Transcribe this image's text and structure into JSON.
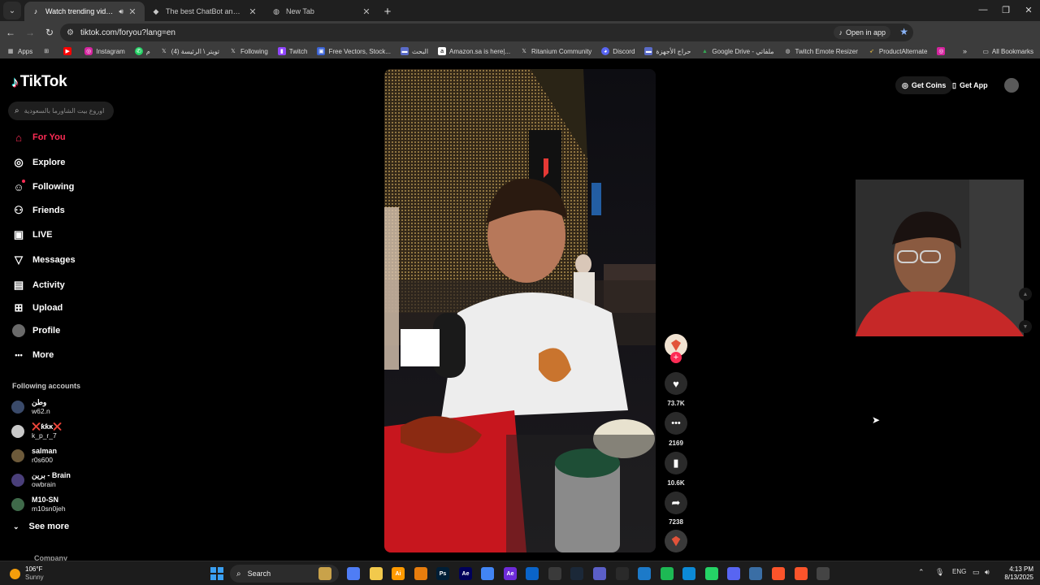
{
  "browser": {
    "tabs": [
      {
        "title": "Watch trending videos for y",
        "active": true,
        "icon": "tiktok-icon"
      },
      {
        "title": "The best ChatBot and Widgets",
        "active": false,
        "icon": "chatbot-icon"
      },
      {
        "title": "New Tab",
        "active": false,
        "icon": "chrome-icon"
      }
    ],
    "url": "tiktok.com/foryou?lang=en",
    "open_in_app": "Open in app"
  },
  "bookmarks": {
    "items": [
      "Apps",
      "Instagram",
      "م",
      "تويتر \\ الرئيسة (4)",
      "Following",
      "Twitch",
      "Free Vectors, Stock...",
      "البحث",
      "Amazon.sa is here|...",
      "Ritanium Community",
      "Discord",
      "حراج الأجهزة",
      "Google Drive - ملفاتي",
      "Twitch Emote Resizer",
      "ProductAlternate"
    ],
    "all_bookmarks": "All Bookmarks"
  },
  "tiktok": {
    "logo": "TikTok",
    "search_placeholder": "اوروع بيت الشاورما بالسعودية",
    "nav": [
      {
        "label": "For You",
        "icon": "home-icon",
        "glyph": "⌂",
        "active": true
      },
      {
        "label": "Explore",
        "icon": "compass-icon",
        "glyph": "◎",
        "active": false
      },
      {
        "label": "Following",
        "icon": "following-user-icon",
        "glyph": "☺",
        "active": false
      },
      {
        "label": "Friends",
        "icon": "friends-icon",
        "glyph": "⚇",
        "active": false
      },
      {
        "label": "LIVE",
        "icon": "live-tv-icon",
        "glyph": "▣",
        "active": false
      },
      {
        "label": "Messages",
        "icon": "messages-icon",
        "glyph": "▽",
        "active": false
      },
      {
        "label": "Activity",
        "icon": "activity-icon",
        "glyph": "▤",
        "active": false
      },
      {
        "label": "Upload",
        "icon": "upload-plus-icon",
        "glyph": "⊞",
        "active": false
      },
      {
        "label": "Profile",
        "icon": "profile-avatar",
        "glyph": "",
        "active": false
      },
      {
        "label": "More",
        "icon": "more-dots-icon",
        "glyph": "•••",
        "active": false
      }
    ],
    "following_header": "Following accounts",
    "accounts": [
      {
        "name": "وطن",
        "handle": "w62.n",
        "color": "#3a4a6a"
      },
      {
        "name": "❌ƙƙĸ❌",
        "handle": "k_p_r_7",
        "color": "#c9c9c9"
      },
      {
        "name": "salman",
        "handle": "r0s600",
        "color": "#6d5a3a"
      },
      {
        "name": "برين - Brain",
        "handle": "owbrain",
        "color": "#4a3f7a"
      },
      {
        "name": "M10-SN",
        "handle": "m10sn0jeh",
        "color": "#3f6a4a"
      }
    ],
    "see_more": "See more",
    "company": "Company",
    "get_coins": "Get Coins",
    "get_app": "Get App",
    "rail": {
      "likes": "73.7K",
      "comments": "2169",
      "saves": "10.6K",
      "shares": "7238"
    }
  },
  "taskbar": {
    "temp": "106°F",
    "condition": "Sunny",
    "search": "Search",
    "lang": "ENG",
    "time": "4:13 PM",
    "date": "8/13/2025"
  },
  "colors": {
    "accent": "#fe2c55",
    "teal": "#25f4ee"
  }
}
